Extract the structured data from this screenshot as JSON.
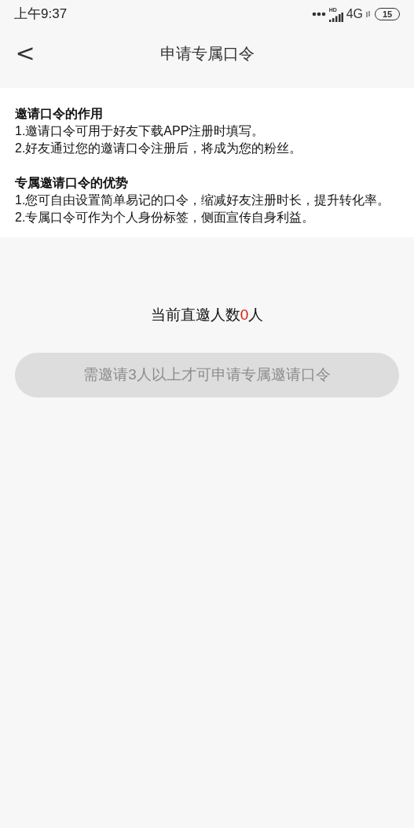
{
  "status_bar": {
    "time": "上午9:37",
    "network_badge": "HD",
    "network": "4G",
    "battery": "15"
  },
  "header": {
    "back": "<",
    "title": "申请专属口令"
  },
  "info": [
    {
      "heading": "邀请口令的作用",
      "lines": [
        "1.邀请口令可用于好友下载APP注册时填写。",
        "2.好友通过您的邀请口令注册后，将成为您的粉丝。"
      ]
    },
    {
      "heading": "专属邀请口令的优势",
      "lines": [
        "1.您可自由设置简单易记的口令，缩减好友注册时长，提升转化率。",
        "2.专属口令可作为个人身份标签，侧面宣传自身利益。"
      ]
    }
  ],
  "invite_count": {
    "label": "当前直邀人数",
    "count": "0",
    "unit": "人"
  },
  "apply_button": {
    "label": "需邀请3人以上才可申请专属邀请口令",
    "disabled": true
  }
}
